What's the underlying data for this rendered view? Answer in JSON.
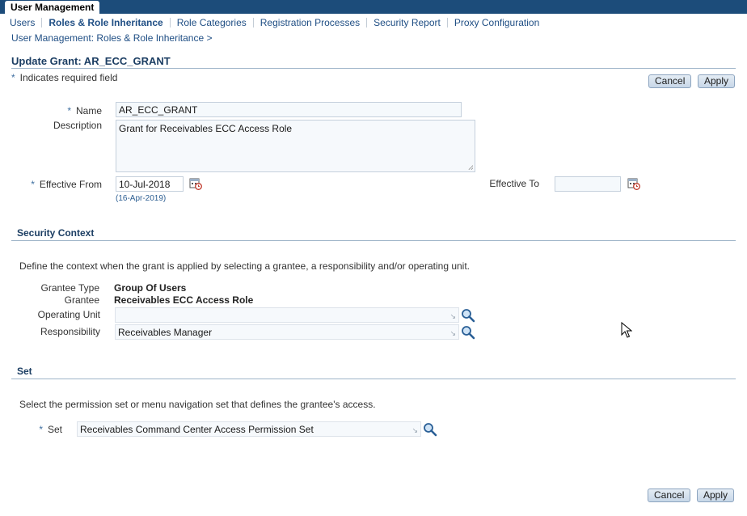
{
  "app": {
    "title": "User Management"
  },
  "tabs": [
    {
      "label": "Users",
      "active": false
    },
    {
      "label": "Roles & Role Inheritance",
      "active": true
    },
    {
      "label": "Role Categories",
      "active": false
    },
    {
      "label": "Registration Processes",
      "active": false
    },
    {
      "label": "Security Report",
      "active": false
    },
    {
      "label": "Proxy Configuration",
      "active": false
    }
  ],
  "breadcrumb": {
    "text": "User Management: Roles & Role Inheritance  >"
  },
  "page": {
    "title": "Update Grant: AR_ECC_GRANT",
    "required_note": "Indicates required field",
    "required_marker": "*"
  },
  "buttons": {
    "cancel": "Cancel",
    "apply": "Apply"
  },
  "form": {
    "name_label": "Name",
    "name_value": "AR_ECC_GRANT",
    "description_label": "Description",
    "description_value": "Grant for Receivables ECC Access Role",
    "effective_from_label": "Effective From",
    "effective_from_value": "10-Jul-2018",
    "effective_from_hint": "(16-Apr-2019)",
    "effective_to_label": "Effective To",
    "effective_to_value": ""
  },
  "security_context": {
    "title": "Security Context",
    "description": "Define the context when the grant is applied by selecting a grantee, a responsibility and/or operating unit.",
    "grantee_type_label": "Grantee Type",
    "grantee_type_value": "Group Of Users",
    "grantee_label": "Grantee",
    "grantee_value": "Receivables ECC Access Role",
    "operating_unit_label": "Operating Unit",
    "operating_unit_value": "",
    "responsibility_label": "Responsibility",
    "responsibility_value": "Receivables Manager"
  },
  "set_section": {
    "title": "Set",
    "description": "Select the permission set or menu navigation set that defines the grantee's access.",
    "set_label": "Set",
    "set_value": "Receivables Command Center Access Permission Set"
  },
  "colors": {
    "header_bar": "#1c4c7a",
    "link": "#1f4e84",
    "section_title": "#1c3e63"
  },
  "icons": [
    "calendar-icon",
    "search-icon",
    "mouse-cursor-icon"
  ]
}
